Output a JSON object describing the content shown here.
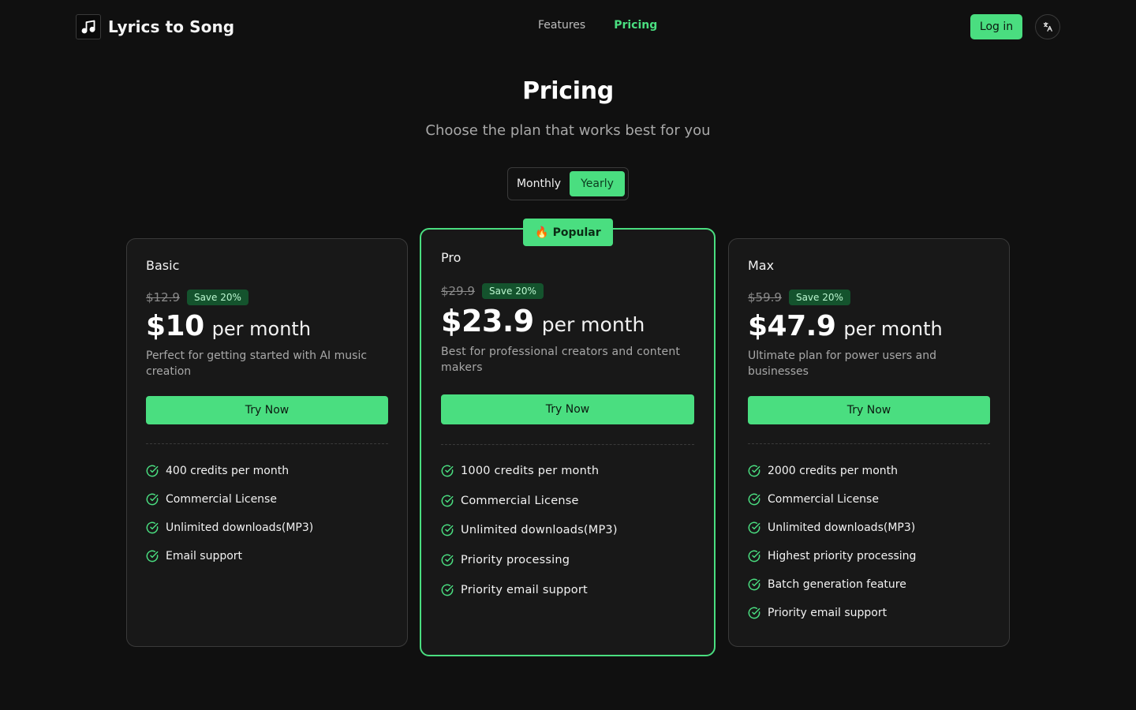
{
  "header": {
    "brand": "Lyrics to Song",
    "nav": [
      {
        "label": "Features",
        "active": false
      },
      {
        "label": "Pricing",
        "active": true
      }
    ],
    "login_label": "Log in",
    "language_icon": "translate-icon",
    "logo_icon": "music-note-icon"
  },
  "hero": {
    "title": "Pricing",
    "subtitle": "Choose the plan that works best for you"
  },
  "billing_toggle": {
    "options": [
      "Monthly",
      "Yearly"
    ],
    "selected": "Yearly"
  },
  "popular_badge": {
    "icon": "fire",
    "label": "🔥 Popular"
  },
  "plans": [
    {
      "name": "Basic",
      "old_price": "$12.9",
      "save": "Save 20%",
      "price": "$10",
      "unit": "per month",
      "description": "Perfect for getting started with AI music creation",
      "cta": "Try Now",
      "features": [
        "400 credits per month",
        "Commercial License",
        "Unlimited downloads(MP3)",
        "Email support"
      ]
    },
    {
      "name": "Pro",
      "old_price": "$29.9",
      "save": "Save 20%",
      "price": "$23.9",
      "unit": "per month",
      "description": "Best for professional creators and content makers",
      "cta": "Try Now",
      "features": [
        "1000 credits per month",
        "Commercial License",
        "Unlimited downloads(MP3)",
        "Priority processing",
        "Priority email support"
      ]
    },
    {
      "name": "Max",
      "old_price": "$59.9",
      "save": "Save 20%",
      "price": "$47.9",
      "unit": "per month",
      "description": "Ultimate plan for power users and businesses",
      "cta": "Try Now",
      "features": [
        "2000 credits per month",
        "Commercial License",
        "Unlimited downloads(MP3)",
        "Highest priority processing",
        "Batch generation feature",
        "Priority email support"
      ]
    }
  ],
  "colors": {
    "background": "#101010",
    "card": "#181818",
    "accent": "#4ade80",
    "save_badge_bg": "#14532d"
  }
}
